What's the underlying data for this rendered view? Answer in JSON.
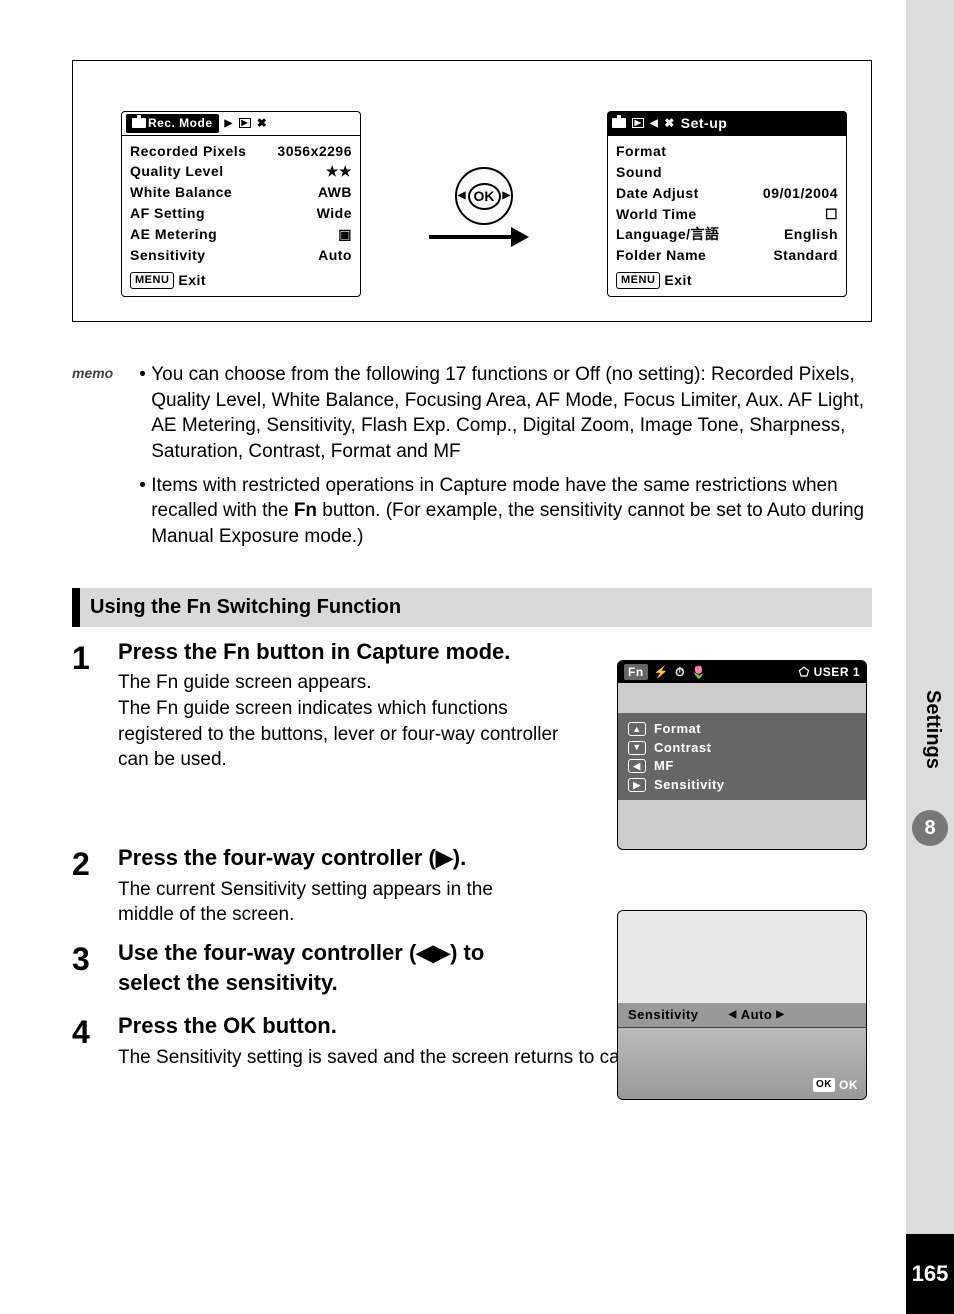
{
  "sidebar": {
    "label": "Settings",
    "chapter": "8",
    "page": "165"
  },
  "rec_mode": {
    "title": "Rec. Mode",
    "rows": [
      {
        "label": "Recorded Pixels",
        "value": "3056x2296"
      },
      {
        "label": "Quality Level",
        "value": "★★"
      },
      {
        "label": "White Balance",
        "value": "AWB"
      },
      {
        "label": "AF Setting",
        "value": "Wide"
      },
      {
        "label": "AE Metering",
        "value": "▣"
      },
      {
        "label": "Sensitivity",
        "value": "Auto"
      }
    ],
    "menu": "MENU",
    "exit": "Exit"
  },
  "setup": {
    "title": "Set-up",
    "rows": [
      {
        "label": "Format",
        "value": ""
      },
      {
        "label": "Sound",
        "value": ""
      },
      {
        "label": "Date Adjust",
        "value": "09/01/2004"
      },
      {
        "label": "World Time",
        "value": "☐"
      },
      {
        "label": "Language/言語",
        "value": "English"
      },
      {
        "label": "Folder Name",
        "value": "Standard"
      }
    ],
    "menu": "MENU",
    "exit": "Exit"
  },
  "ok_button": "OK",
  "memo": {
    "label": "memo",
    "bullet1": "You can choose from the following 17 functions or Off (no setting): Recorded Pixels, Quality Level, White Balance, Focusing Area, AF Mode, Focus Limiter, Aux. AF Light, AE Metering, Sensitivity, Flash Exp. Comp., Digital Zoom, Image Tone, Sharpness, Saturation, Contrast, Format and MF",
    "bullet2a": "Items with restricted operations in Capture mode have the same restrictions when recalled with the ",
    "bullet2fn": "Fn",
    "bullet2b": " button. (For example, the sensitivity cannot be set to Auto during Manual Exposure mode.)"
  },
  "section_title": "Using the Fn Switching Function",
  "steps": [
    {
      "num": "1",
      "title_a": "Press the ",
      "title_fn": "Fn",
      "title_b": " button in Capture mode.",
      "text": "The Fn guide screen appears.\nThe Fn guide screen indicates which functions registered to the buttons, lever or four-way controller can be used."
    },
    {
      "num": "2",
      "title_a": "Press the four-way controller (▶).",
      "title_fn": "",
      "title_b": "",
      "text": "The current Sensitivity setting appears in the middle of the screen."
    },
    {
      "num": "3",
      "title_a": "Use the four-way controller (◀▶) to select the sensitivity.",
      "title_fn": "",
      "title_b": "",
      "text": ""
    },
    {
      "num": "4",
      "title_a": "Press the ",
      "title_fn": "OK",
      "title_b": " button.",
      "text": "The Sensitivity setting is saved and the screen returns to capture status."
    }
  ],
  "shot1": {
    "status_left": "Fn",
    "status_right": "USER 1",
    "rows": [
      {
        "dir": "▲",
        "label": "Format"
      },
      {
        "dir": "▼",
        "label": "Contrast"
      },
      {
        "dir": "◀",
        "label": "MF"
      },
      {
        "dir": "▶",
        "label": "Sensitivity"
      }
    ]
  },
  "shot2": {
    "label": "Sensitivity",
    "value": "Auto",
    "ok": "OK"
  }
}
